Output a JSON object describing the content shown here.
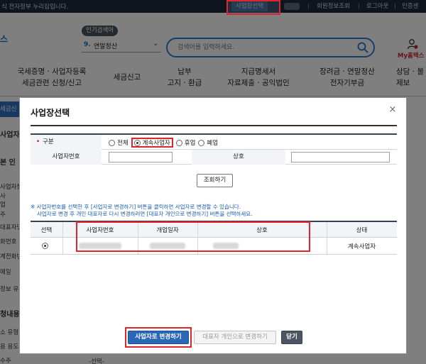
{
  "topbar": {
    "notice": "식 전자정부 누리집입니다.",
    "select_business": "사업장선택",
    "member_info": "회원정보조회",
    "logout": "로그아웃",
    "cert_center": "인증센"
  },
  "header": {
    "logo_fragment": "스",
    "popular_badge": "인기검색어",
    "popular_rank": "9.",
    "popular_keyword": "연말정산",
    "search_placeholder": "검색어를 입력하세요.",
    "my_hometax": "My홈택스"
  },
  "gnb": [
    {
      "line1": "국세증명 · 사업자등록",
      "line2": "세금관련 신청/신고"
    },
    {
      "line1": "세금신고",
      "line2": ""
    },
    {
      "line1": "납부",
      "line2": "고지 · 환급"
    },
    {
      "line1": "지급명세서",
      "line2": "자료제출 · 공익법인"
    },
    {
      "line1": "장려금 · 연말정산",
      "line2": "전자기부금"
    },
    {
      "line1": "상담 · 불",
      "line2": "제보"
    }
  ],
  "left_fragments": [
    "세금신",
    "사업자등록",
    "본 인",
    "사업자등",
    "사",
    "업",
    "주",
    "대표자명",
    "화번호",
    "계전화번",
    "메일",
    "정보 유",
    "청내용",
    "소 유형",
    "용 용도",
    "수주"
  ],
  "modal": {
    "title": "사업장선택",
    "close_glyph": "×",
    "form": {
      "type_label": "구분",
      "required_mark": "•",
      "type_options": [
        "전체",
        "계속사업자",
        "휴업",
        "폐업"
      ],
      "selected_option": "계속사업자",
      "bizno_label": "사업자번호",
      "bizno_value": "",
      "name_label": "상호",
      "name_value": ""
    },
    "search_button": "조회하기",
    "notes": [
      "※ 사업자번호를 선택한 후 [사업자로 변경하기] 버튼을 클릭하면 사업자로 변경할 수 있습니다.",
      "사업자로 변경 후 개인 대표자로 다시 변경하려면 [대표자 개인으로 변경하기] 버튼을 선택하세요."
    ],
    "grid": {
      "columns": [
        "선택",
        "사업자번호",
        "개업일자",
        "상호",
        "상태"
      ],
      "rows": [
        {
          "selected": true,
          "status": "계속사업자"
        }
      ]
    },
    "buttons": {
      "change_to_business": "사업자로 변경하기",
      "change_to_representative": "대표자 개인으로 변경하기",
      "close": "닫기"
    }
  },
  "bottom_select": "-선택-",
  "colors": {
    "accent_blue": "#2b67b9",
    "highlight_red": "#e0252f",
    "topbar_bg": "#1e2a3a",
    "note_blue": "#1a5fb4"
  }
}
